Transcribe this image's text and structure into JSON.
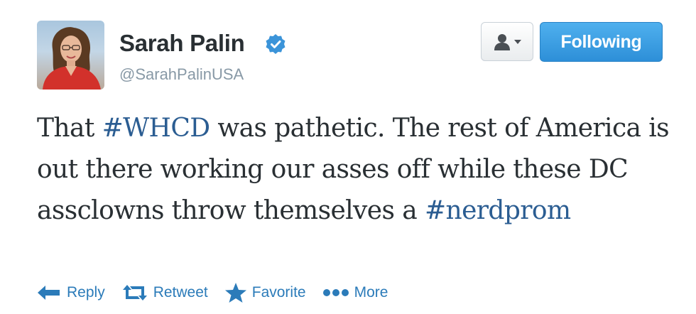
{
  "user": {
    "name": "Sarah Palin",
    "handle": "@SarahPalinUSA",
    "verified": true
  },
  "buttons": {
    "user_menu_icon": "person-dropdown-icon",
    "follow_label": "Following"
  },
  "tweet": {
    "segments": [
      {
        "text": "That ",
        "type": "text"
      },
      {
        "text": "#WHCD",
        "type": "hashtag"
      },
      {
        "text": " was pathetic. The rest of America is out there working our asses off while these DC assclowns throw themselves a ",
        "type": "text"
      },
      {
        "text": "#nerdprom",
        "type": "hashtag"
      }
    ]
  },
  "actions": {
    "reply": {
      "label": "Reply",
      "icon": "reply-arrow-icon"
    },
    "retweet": {
      "label": "Retweet",
      "icon": "retweet-icon"
    },
    "favorite": {
      "label": "Favorite",
      "icon": "star-icon"
    },
    "more": {
      "label": "More",
      "icon": "dots-icon"
    }
  },
  "colors": {
    "link": "#2b7bb9",
    "hashtag": "#2b5d92",
    "follow_button": "#3a9de3",
    "verified": "#3b94d9",
    "text": "#292f33",
    "handle": "#8899a6"
  }
}
